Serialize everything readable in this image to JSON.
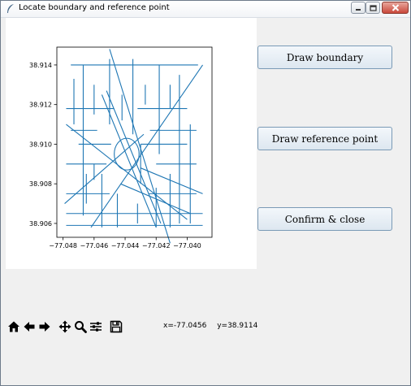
{
  "window": {
    "title": "Locate boundary and reference point"
  },
  "buttons": {
    "draw_boundary": "Draw boundary",
    "draw_reference": "Draw reference point",
    "confirm_close": "Confirm & close"
  },
  "toolbar": {
    "tools": [
      "home-icon",
      "back-icon",
      "forward-icon",
      "pan-icon",
      "zoom-icon",
      "configure-subplots-icon",
      "save-icon"
    ]
  },
  "status": {
    "x_readout": "x=-77.0456",
    "y_readout": "y=38.9114"
  },
  "colors": {
    "street": "#1f77b4",
    "plot_bg": "#ffffff",
    "window_bg": "#f0f0f0"
  },
  "chart_data": {
    "type": "line",
    "title": "",
    "xlabel": "",
    "ylabel": "",
    "xlim": [
      -77.0484,
      -77.0384
    ],
    "ylim": [
      38.9053,
      38.9149
    ],
    "xticks": [
      -77.048,
      -77.046,
      -77.044,
      -77.042,
      -77.04
    ],
    "xtick_labels": [
      "−77.048",
      "−77.046",
      "−77.044",
      "−77.042",
      "−77.040"
    ],
    "yticks": [
      38.906,
      38.908,
      38.91,
      38.912,
      38.914
    ],
    "ytick_labels": [
      "38.906",
      "38.908",
      "38.910",
      "38.912",
      "38.914"
    ],
    "grid": false,
    "circle": {
      "cx": -77.0439,
      "cy": 38.9095,
      "r": 0.0008
    },
    "segments": [
      [
        [
          -77.0475,
          38.914
        ],
        [
          -77.0393,
          38.914
        ]
      ],
      [
        [
          -77.0478,
          38.9118
        ],
        [
          -77.0447,
          38.9118
        ]
      ],
      [
        [
          -77.0432,
          38.9118
        ],
        [
          -77.04,
          38.9118
        ]
      ],
      [
        [
          -77.0475,
          38.9107
        ],
        [
          -77.0458,
          38.9107
        ]
      ],
      [
        [
          -77.0424,
          38.9107
        ],
        [
          -77.0394,
          38.9107
        ]
      ],
      [
        [
          -77.0478,
          38.909
        ],
        [
          -77.0452,
          38.909
        ]
      ],
      [
        [
          -77.042,
          38.909
        ],
        [
          -77.0394,
          38.909
        ]
      ],
      [
        [
          -77.0478,
          38.9075
        ],
        [
          -77.045,
          38.9075
        ]
      ],
      [
        [
          -77.0425,
          38.9075
        ],
        [
          -77.0394,
          38.9075
        ]
      ],
      [
        [
          -77.0478,
          38.9065
        ],
        [
          -77.039,
          38.9065
        ]
      ],
      [
        [
          -77.0478,
          38.9059
        ],
        [
          -77.039,
          38.9059
        ]
      ],
      [
        [
          -77.047,
          38.91
        ],
        [
          -77.0449,
          38.91
        ]
      ],
      [
        [
          -77.043,
          38.91
        ],
        [
          -77.04,
          38.91
        ]
      ],
      [
        [
          -77.0467,
          38.914
        ],
        [
          -77.0467,
          38.9064
        ]
      ],
      [
        [
          -77.045,
          38.9143
        ],
        [
          -77.045,
          38.911
        ]
      ],
      [
        [
          -77.0435,
          38.9143
        ],
        [
          -77.0435,
          38.9105
        ]
      ],
      [
        [
          -77.0418,
          38.914
        ],
        [
          -77.0418,
          38.9095
        ]
      ],
      [
        [
          -77.0405,
          38.9135
        ],
        [
          -77.0405,
          38.906
        ]
      ],
      [
        [
          -77.0398,
          38.911
        ],
        [
          -77.0398,
          38.906
        ]
      ],
      [
        [
          -77.0432,
          38.907
        ],
        [
          -77.0432,
          38.906
        ]
      ],
      [
        [
          -77.0455,
          38.9085
        ],
        [
          -77.0455,
          38.9058
        ]
      ],
      [
        [
          -77.0445,
          38.9075
        ],
        [
          -77.0445,
          38.9058
        ]
      ],
      [
        [
          -77.042,
          38.9078
        ],
        [
          -77.042,
          38.9058
        ]
      ],
      [
        [
          -77.0411,
          38.9085
        ],
        [
          -77.0411,
          38.9058
        ]
      ],
      [
        [
          -77.0478,
          38.911
        ],
        [
          -77.04,
          38.9062
        ]
      ],
      [
        [
          -77.039,
          38.914
        ],
        [
          -77.0462,
          38.9058
        ]
      ],
      [
        [
          -77.0479,
          38.907
        ],
        [
          -77.0428,
          38.9105
        ]
      ],
      [
        [
          -77.045,
          38.9148
        ],
        [
          -77.0411,
          38.905
        ]
      ],
      [
        [
          -77.0455,
          38.9125
        ],
        [
          -77.042,
          38.9058
        ]
      ],
      [
        [
          -77.0452,
          38.9127
        ],
        [
          -77.0417,
          38.906
        ]
      ],
      [
        [
          -77.0443,
          38.908
        ],
        [
          -77.0398,
          38.9065
        ]
      ],
      [
        [
          -77.043,
          38.9088
        ],
        [
          -77.039,
          38.9075
        ]
      ],
      [
        [
          -77.0473,
          38.9133
        ],
        [
          -77.0473,
          38.911
        ]
      ],
      [
        [
          -77.046,
          38.913
        ],
        [
          -77.046,
          38.9115
        ]
      ],
      [
        [
          -77.0442,
          38.9125
        ],
        [
          -77.0442,
          38.9112
        ]
      ],
      [
        [
          -77.0427,
          38.913
        ],
        [
          -77.0427,
          38.912
        ]
      ],
      [
        [
          -77.0411,
          38.913
        ],
        [
          -77.0411,
          38.9118
        ]
      ],
      [
        [
          -77.0465,
          38.9085
        ],
        [
          -77.0465,
          38.907
        ]
      ],
      [
        [
          -77.046,
          38.909
        ],
        [
          -77.046,
          38.9082
        ]
      ],
      [
        [
          -77.043,
          38.91
        ],
        [
          -77.043,
          38.908
        ]
      ]
    ]
  }
}
